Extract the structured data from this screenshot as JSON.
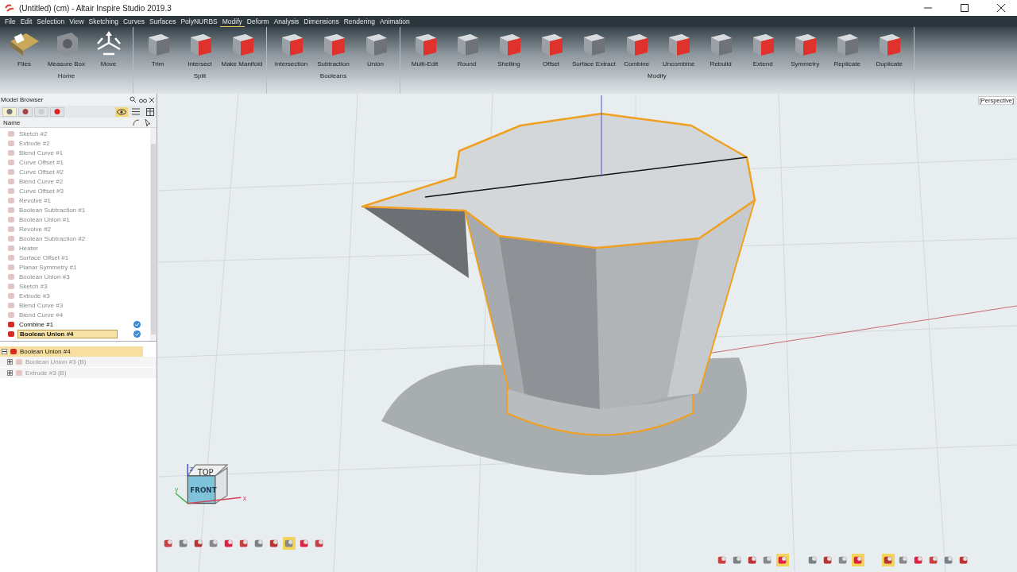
{
  "window": {
    "title": "(Untitled) (cm) - Altair Inspire Studio 2019.3"
  },
  "menu": [
    {
      "label": "File",
      "selected": false
    },
    {
      "label": "Edit",
      "selected": false
    },
    {
      "label": "Selection",
      "selected": false
    },
    {
      "label": "View",
      "selected": false
    },
    {
      "label": "Sketching",
      "selected": false
    },
    {
      "label": "Curves",
      "selected": false
    },
    {
      "label": "Surfaces",
      "selected": false
    },
    {
      "label": "PolyNURBS",
      "selected": false
    },
    {
      "label": "Modify",
      "selected": true
    },
    {
      "label": "Deform",
      "selected": false
    },
    {
      "label": "Analysis",
      "selected": false
    },
    {
      "label": "Dimensions",
      "selected": false
    },
    {
      "label": "Rendering",
      "selected": false
    },
    {
      "label": "Animation",
      "selected": false
    }
  ],
  "ribbon": [
    {
      "name": "Home",
      "tools": [
        "Files",
        "Measure Box",
        "Move"
      ]
    },
    {
      "name": "Split",
      "tools": [
        "Trim",
        "Intersect",
        "Make Manifold"
      ]
    },
    {
      "name": "Booleans",
      "tools": [
        "Intersection",
        "Subtraction",
        "Union"
      ]
    },
    {
      "name": "Modify",
      "tools": [
        "Multi-Edit",
        "Round",
        "Shelling",
        "Offset",
        "Surface Extract",
        "Combine",
        "Uncombine",
        "Rebuild",
        "Extend",
        "Symmetry",
        "Replicate",
        "Duplicate"
      ]
    }
  ],
  "model_browser": {
    "title": "Model Browser",
    "tabs": [
      {
        "selected": true
      },
      {
        "selected": false
      },
      {
        "selected": false
      },
      {
        "selected": false
      }
    ],
    "visibility_on": true,
    "column": "Name",
    "items": [
      {
        "label": "Sketch #2",
        "active": false,
        "checked": false,
        "selected": false
      },
      {
        "label": "Extrude #2",
        "active": false,
        "checked": false,
        "selected": false
      },
      {
        "label": "Blend Curve #1",
        "active": false,
        "checked": false,
        "selected": false
      },
      {
        "label": "Curve Offset #1",
        "active": false,
        "checked": false,
        "selected": false
      },
      {
        "label": "Curve Offset #2",
        "active": false,
        "checked": false,
        "selected": false
      },
      {
        "label": "Blend Curve #2",
        "active": false,
        "checked": false,
        "selected": false
      },
      {
        "label": "Curve Offset #3",
        "active": false,
        "checked": false,
        "selected": false
      },
      {
        "label": "Revolve #1",
        "active": false,
        "checked": false,
        "selected": false
      },
      {
        "label": "Boolean Subtraction #1",
        "active": false,
        "checked": false,
        "selected": false
      },
      {
        "label": "Boolean Union #1",
        "active": false,
        "checked": false,
        "selected": false
      },
      {
        "label": "Revolve #2",
        "active": false,
        "checked": false,
        "selected": false
      },
      {
        "label": "Boolean Subtraction #2",
        "active": false,
        "checked": false,
        "selected": false
      },
      {
        "label": "Heater",
        "active": false,
        "checked": false,
        "selected": false
      },
      {
        "label": "Surface Offset #1",
        "active": false,
        "checked": false,
        "selected": false
      },
      {
        "label": "Planar Symmetry #1",
        "active": false,
        "checked": false,
        "selected": false
      },
      {
        "label": "Boolean Union #3",
        "active": false,
        "checked": false,
        "selected": false
      },
      {
        "label": "Sketch #3",
        "active": false,
        "checked": false,
        "selected": false
      },
      {
        "label": "Extrude #3",
        "active": false,
        "checked": false,
        "selected": false
      },
      {
        "label": "Blend Curve #3",
        "active": false,
        "checked": false,
        "selected": false
      },
      {
        "label": "Blend Curve #4",
        "active": false,
        "checked": false,
        "selected": false
      },
      {
        "label": "Combine #1",
        "active": true,
        "checked": true,
        "selected": false
      },
      {
        "label": "Boolean Union #4",
        "active": true,
        "checked": true,
        "selected": true
      }
    ],
    "history": [
      {
        "label": "Boolean Union #4",
        "expanded": true,
        "selected": true,
        "children": [
          {
            "label": "Boolean Union #3 (B)",
            "expanded": false,
            "selected": false
          },
          {
            "label": "Extrude #3 (B)",
            "expanded": false,
            "selected": false
          }
        ]
      }
    ]
  },
  "viewport": {
    "view_label": "[Perspective]",
    "view_cube": {
      "top": "TOP",
      "front": "FRONT",
      "axes": [
        "x",
        "y",
        "z"
      ]
    },
    "view_toolbar": [
      {
        "on": false
      },
      {
        "on": false
      },
      {
        "on": false
      },
      {
        "on": false
      },
      {
        "on": false
      },
      {
        "on": false
      },
      {
        "on": false
      },
      {
        "on": false
      },
      {
        "on": true
      },
      {
        "on": false
      },
      {
        "on": false
      }
    ],
    "snap_toolbars": [
      [
        {
          "on": false
        },
        {
          "on": false
        },
        {
          "on": false
        },
        {
          "on": false
        },
        {
          "on": true
        }
      ],
      [
        {
          "on": false
        },
        {
          "on": false
        },
        {
          "on": false
        },
        {
          "on": true
        }
      ],
      [
        {
          "on": true
        },
        {
          "on": false
        },
        {
          "on": false
        },
        {
          "on": false
        },
        {
          "on": false
        },
        {
          "on": false
        }
      ]
    ]
  }
}
